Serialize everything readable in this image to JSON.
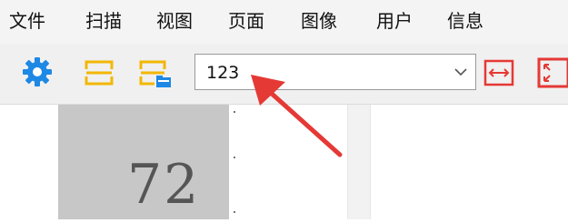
{
  "menubar": {
    "items": [
      {
        "label": "文件"
      },
      {
        "label": "扫描"
      },
      {
        "label": "视图"
      },
      {
        "label": "页面"
      },
      {
        "label": "图像"
      },
      {
        "label": "用户"
      },
      {
        "label": "信息"
      }
    ]
  },
  "toolbar": {
    "icons": [
      "gear-icon",
      "split-pages-icon",
      "split-pages-folder-icon",
      "fit-width-icon",
      "fit-page-icon"
    ],
    "combo": {
      "value": "123"
    }
  },
  "viewer": {
    "page_number": "72"
  },
  "colors": {
    "accent_blue": "#1e88e5",
    "icon_yellow": "#f2b705",
    "icon_red": "#e53935",
    "annotation_arrow": "#e53935"
  }
}
